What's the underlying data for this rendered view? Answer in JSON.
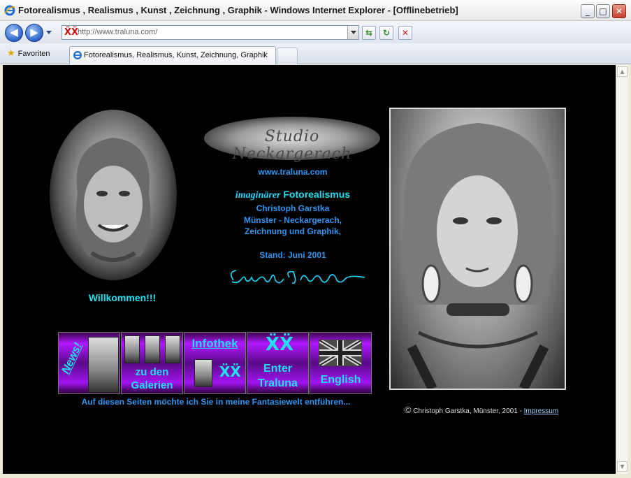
{
  "window": {
    "title": "Fotorealismus , Realismus , Kunst , Zeichnung , Graphik - Windows Internet Explorer - [Offlinebetrieb]",
    "minimize": "_",
    "maximize": "□",
    "close": "✕"
  },
  "toolbar": {
    "back": "◀",
    "forward": "▶",
    "address_url": "http://www.traluna.com/",
    "favicon": "ẌẌ",
    "refresh": "↻",
    "compat": "⇆",
    "stop": "✕"
  },
  "tabs": {
    "favorites_label": "Favoriten",
    "active_tab_label": "Fotorealismus, Realismus, Kunst, Zeichnung, Graphik"
  },
  "page": {
    "studio_logo": "Studio Neckargerach",
    "site_url": "www.traluna.com",
    "imaginary": "imaginärer",
    "fotorealismus": "Fotorealismus",
    "author": "Christoph Garstka",
    "places": "Münster - Neckargerach,",
    "drawing": "Zeichnung und Graphik,",
    "stand": "Stand: Juni 2001",
    "signature": "Christoph Garstka",
    "welcome": "Willkommen!!!",
    "nav": {
      "news": "News!",
      "galleries_line1": "zu den",
      "galleries_line2": "Galerien",
      "infothek": "Infothek",
      "enter_line1": "Enter",
      "enter_line2": "Traluna",
      "english": "English",
      "logo_mark": "ẌẌ"
    },
    "fantasy": "Auf diesen Seiten möchte ich Sie in meine Fantasiewelt entführen...",
    "copyright_symbol": "©",
    "copyright_text": "Christoph Garstka, Münster, 2001 -",
    "impressum": "Impressum"
  },
  "colors": {
    "link_blue": "#2e95f0",
    "cyan": "#22e0f0",
    "purple": "#b218ff",
    "background": "#000000"
  }
}
